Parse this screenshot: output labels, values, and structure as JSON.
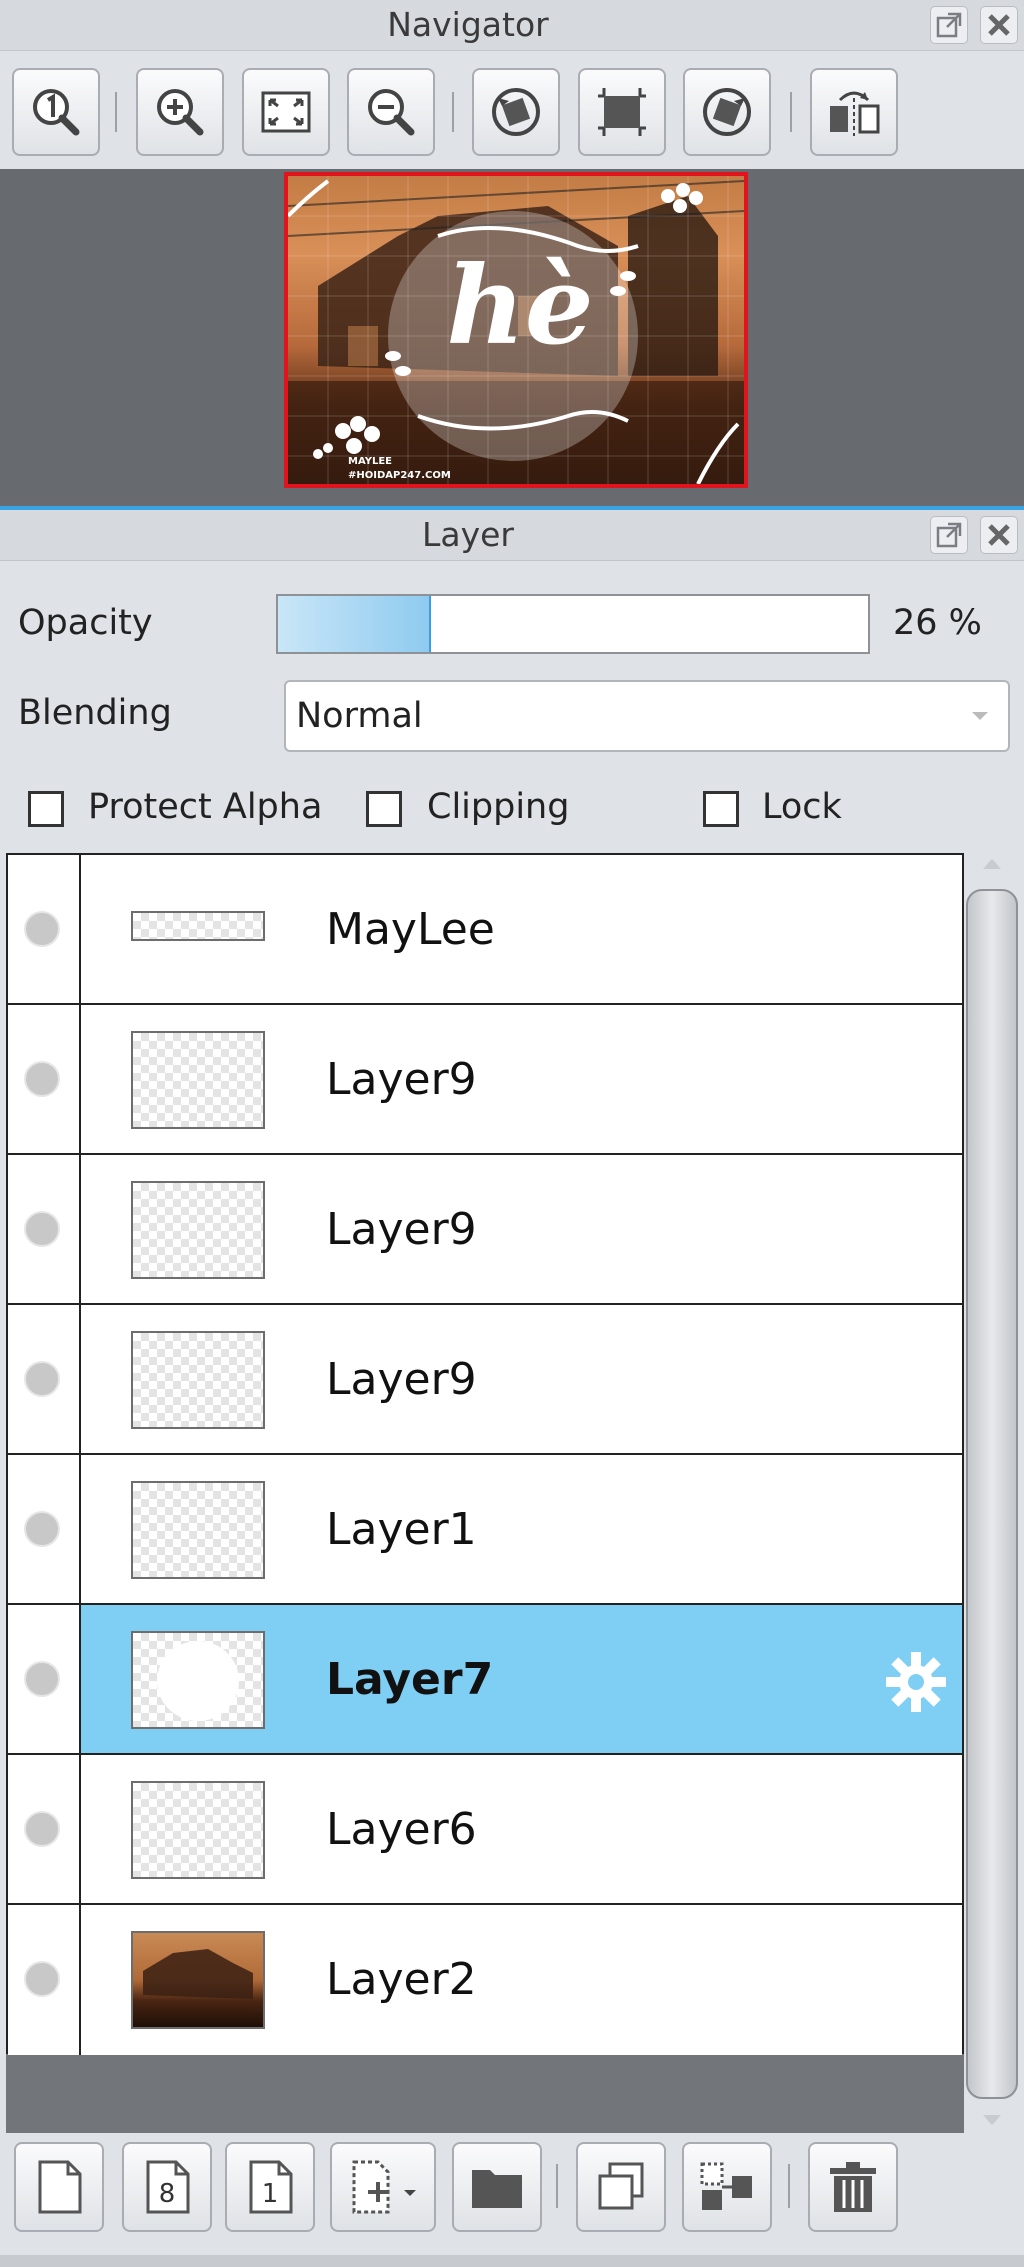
{
  "navigator": {
    "title": "Navigator",
    "toolbar": [
      {
        "icon": "actual-size-icon"
      },
      {
        "icon": "zoom-in-icon"
      },
      {
        "icon": "fit-screen-icon"
      },
      {
        "icon": "zoom-out-icon"
      },
      {
        "icon": "rotate-left-icon"
      },
      {
        "icon": "reset-rotation-icon"
      },
      {
        "icon": "rotate-right-icon"
      },
      {
        "icon": "flip-horizontal-icon"
      }
    ],
    "preview": {
      "overlay_text": "hè",
      "watermark_line1": "MAYLEE",
      "watermark_line2": "#HOIDAP247.COM",
      "border_color": "#e0141c"
    }
  },
  "layer_panel": {
    "title": "Layer",
    "opacity_label": "Opacity",
    "opacity_value": 26,
    "opacity_text": "26 %",
    "blending_label": "Blending",
    "blending_value": "Normal",
    "checkboxes": {
      "protect_alpha": {
        "label": "Protect Alpha",
        "checked": false
      },
      "clipping": {
        "label": "Clipping",
        "checked": false
      },
      "lock": {
        "label": "Lock",
        "checked": false
      }
    },
    "layers": [
      {
        "name": "MayLee",
        "selected": false
      },
      {
        "name": "Layer9",
        "selected": false
      },
      {
        "name": "Layer9",
        "selected": false
      },
      {
        "name": "Layer9",
        "selected": false
      },
      {
        "name": "Layer1",
        "selected": false
      },
      {
        "name": "Layer7",
        "selected": true
      },
      {
        "name": "Layer6",
        "selected": false
      },
      {
        "name": "Layer2",
        "selected": false
      }
    ],
    "bottom_toolbar": [
      {
        "icon": "new-layer-icon"
      },
      {
        "icon": "new-8bit-layer-icon",
        "text": "8"
      },
      {
        "icon": "new-1bit-layer-icon",
        "text": "1"
      },
      {
        "icon": "add-layer-menu-icon"
      },
      {
        "icon": "new-folder-icon"
      },
      {
        "icon": "duplicate-layer-icon"
      },
      {
        "icon": "merge-down-icon"
      },
      {
        "icon": "delete-layer-icon"
      }
    ],
    "selected_color": "#7fcff5"
  }
}
